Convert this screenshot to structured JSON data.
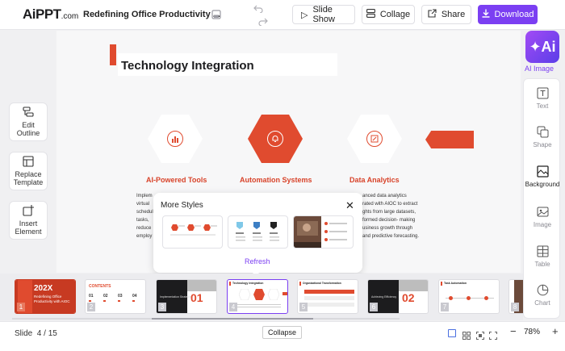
{
  "app": {
    "logo": "AiPPT",
    "logo_domain": ".com",
    "doc_title": "Redefining Office Productivity ..."
  },
  "toolbar": {
    "slideshow": "Slide Show",
    "collage": "Collage",
    "share": "Share",
    "download": "Download"
  },
  "slide": {
    "title": "Technology Integration",
    "features": [
      {
        "label": "AI-Powered Tools",
        "icon": "chart-icon"
      },
      {
        "label": "Automation Systems",
        "icon": "bell-icon"
      },
      {
        "label": "Data Analytics",
        "icon": "edit-icon"
      }
    ],
    "left_text": [
      "Implem",
      "virtual",
      "schedul",
      "tasks,",
      "reduce",
      "employ"
    ],
    "right_text": [
      "anced data analytics",
      "rated with AIOC to extract",
      "ghts from large datasets,",
      "formed decision- making",
      "usiness growth through",
      "and predictive forecasting."
    ]
  },
  "left_tools": [
    {
      "label": "Edit Outline",
      "icon": "outline-icon"
    },
    {
      "label": "Replace Template",
      "icon": "template-icon"
    },
    {
      "label": "Insert Element",
      "icon": "insert-icon"
    }
  ],
  "right_tools": {
    "ai_label": "AI Image",
    "items": [
      {
        "label": "Text",
        "icon": "text-icon"
      },
      {
        "label": "Shape",
        "icon": "shape-icon"
      },
      {
        "label": "Background",
        "icon": "background-icon",
        "active": true
      },
      {
        "label": "Image",
        "icon": "image-icon"
      },
      {
        "label": "Table",
        "icon": "table-icon"
      },
      {
        "label": "Chart",
        "icon": "chart-icon"
      }
    ]
  },
  "popup": {
    "title": "More Styles",
    "refresh": "Refresh"
  },
  "thumbnails": [
    {
      "num": "1",
      "big_text": "202X",
      "sub_text": "Redefining Office Productivity with AIOC"
    },
    {
      "num": "2",
      "head": "CONTENTS",
      "nums": [
        "01",
        "02",
        "03",
        "04"
      ]
    },
    {
      "num": "3",
      "big_text": "01",
      "caption": "Implementation Strategies"
    },
    {
      "num": "4",
      "head": "Technology Integration"
    },
    {
      "num": "5",
      "head": "Organizational Transformation"
    },
    {
      "num": "6",
      "big_text": "02",
      "caption": "Achieving Efficiency"
    },
    {
      "num": "7",
      "head": "Task Automation"
    },
    {
      "num": "8"
    }
  ],
  "status": {
    "slide_label": "Slide",
    "current": "4",
    "total": "15",
    "slide_text": "Slide  4 / 15",
    "collapse": "Collapse",
    "zoom": "78%",
    "minus": "−",
    "plus": "+"
  }
}
